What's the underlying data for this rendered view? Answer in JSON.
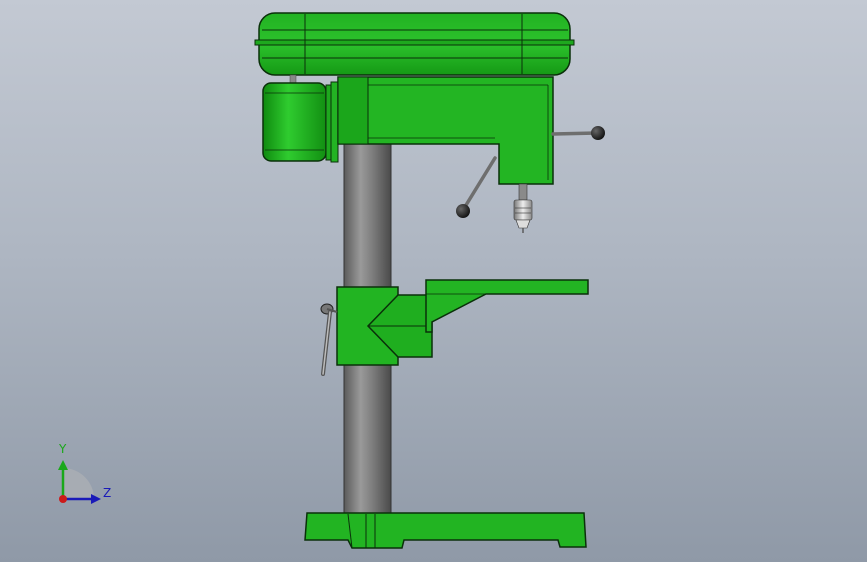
{
  "model": {
    "name": "drill press",
    "colors": {
      "body": "#22bb22",
      "body_dark": "#0f7a0f",
      "body_light": "#5ee05e",
      "outline": "#0a300a",
      "column": "#7a7a7a",
      "background_top": "#c3c9d3",
      "background_bottom": "#8f99a7"
    }
  },
  "triad": {
    "y_label": "Y",
    "z_label": "Z",
    "y_color": "#1aa81a",
    "z_color": "#1a1ab8",
    "x_color": "#cc1a1a"
  }
}
